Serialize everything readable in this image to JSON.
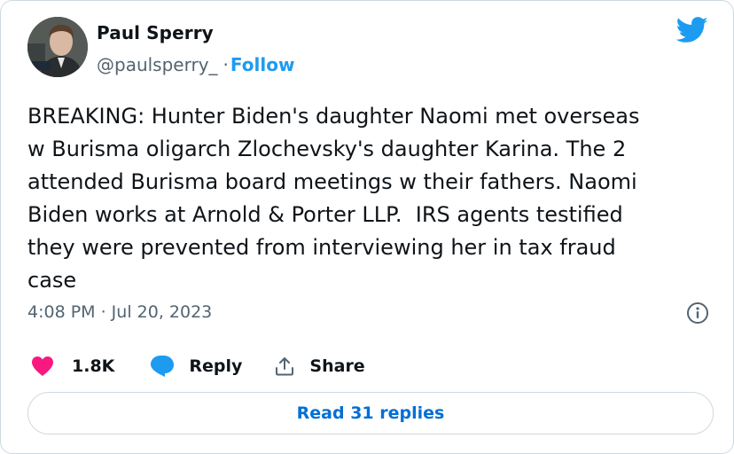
{
  "tweet": {
    "author_name": "Paul Sperry",
    "handle": "@paulsperry_",
    "separator": "·",
    "follow_label": "Follow",
    "text": "BREAKING: Hunter Biden's daughter Naomi met overseas\nw Burisma oligarch Zlochevsky's daughter Karina. The 2\nattended Burisma board meetings w their fathers. Naomi\nBiden works at Arnold & Porter LLP.  IRS agents testified\nthey were prevented from interviewing her in tax fraud\ncase",
    "timestamp": "4:08 PM · Jul 20, 2023",
    "likes": "1.8K",
    "reply_label": "Reply",
    "share_label": "Share",
    "read_replies_label": "Read 31 replies"
  },
  "icons": {
    "brand": "twitter-bird-icon",
    "info": "info-icon",
    "like": "heart-icon",
    "reply": "speech-bubble-icon",
    "share": "share-upload-icon"
  },
  "colors": {
    "brand_blue": "#1d9bf0",
    "link_blue": "#006fd6",
    "like_pink": "#f91880",
    "muted_text": "#536471",
    "border": "#cfd9de"
  }
}
